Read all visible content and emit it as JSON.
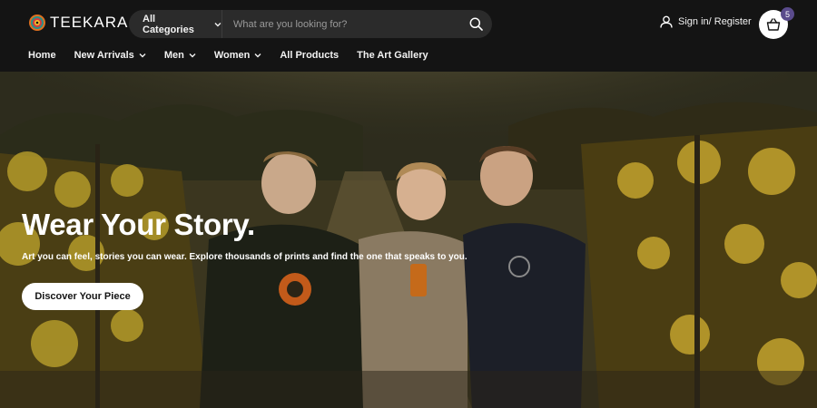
{
  "brand": {
    "name": "TEEKARA"
  },
  "search": {
    "category_label": "All Categories",
    "placeholder": "What are you looking for?"
  },
  "account": {
    "signin_label": "Sign in/ Register"
  },
  "cart": {
    "count": "5"
  },
  "nav": {
    "items": [
      {
        "label": "Home",
        "has_dropdown": false
      },
      {
        "label": "New Arrivals",
        "has_dropdown": true
      },
      {
        "label": "Men",
        "has_dropdown": true
      },
      {
        "label": "Women",
        "has_dropdown": true
      },
      {
        "label": "All Products",
        "has_dropdown": false
      },
      {
        "label": "The Art Gallery",
        "has_dropdown": false
      }
    ]
  },
  "hero": {
    "title": "Wear Your Story.",
    "subtitle": "Art you can feel, stories you can wear. Explore thousands of prints and find the one that speaks to you.",
    "cta_label": "Discover Your Piece"
  },
  "icons": {
    "logo": "mandala-logo-icon",
    "search": "search-icon",
    "user": "user-icon",
    "cart": "shopping-basket-icon",
    "chevron": "chevron-down-icon"
  },
  "colors": {
    "header_bg": "#141414",
    "search_bg": "#2b2b2b",
    "badge": "#5a4b8c",
    "cta_bg": "#ffffff"
  }
}
